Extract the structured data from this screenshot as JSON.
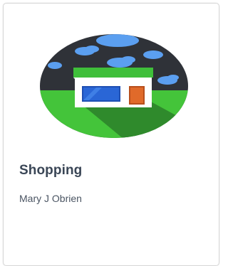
{
  "card": {
    "title": "Shopping",
    "author": "Mary J Obrien",
    "image_icon": "shop-storefront-illustration"
  },
  "colors": {
    "sky": "#2f3238",
    "cloud": "#5b9ff0",
    "grass": "#44c43a",
    "shadow": "#2f8a2c",
    "awning": "#3fbf3a",
    "store_wall": "#ffffff",
    "window": "#2a66d6",
    "door": "#e06a2a",
    "title_text": "#3a4656",
    "author_text": "#4b5563"
  }
}
